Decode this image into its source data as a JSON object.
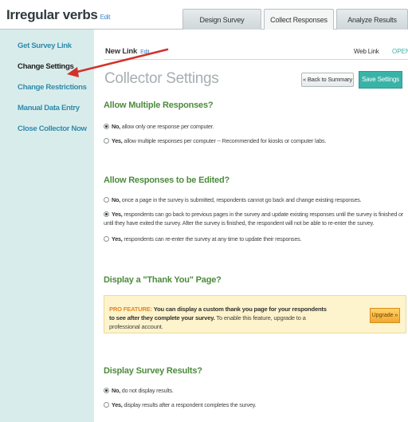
{
  "header": {
    "survey_title": "Irregular verbs",
    "edit": "Edit",
    "tabs": [
      "Design Survey",
      "Collect Responses",
      "Analyze Results"
    ],
    "active_tab": "Collect Responses"
  },
  "sidebar": {
    "items": [
      {
        "label": "Get Survey Link"
      },
      {
        "label": "Change Settings"
      },
      {
        "label": "Change Restrictions"
      },
      {
        "label": "Manual Data Entry"
      },
      {
        "label": "Close Collector Now"
      }
    ],
    "active": "Change Settings"
  },
  "main": {
    "new_link": "New Link",
    "edit": "Edit",
    "web_link": "Web Link",
    "status": "OPEN",
    "title": "Collector Settings",
    "back_button": "« Back to Summary",
    "save_button": "Save Settings"
  },
  "sections": {
    "multiple": {
      "heading": "Allow Multiple Responses?",
      "options": [
        {
          "lead": "No,",
          "text": " allow only one response per computer.",
          "checked": true
        },
        {
          "lead": "Yes,",
          "text": " allow multiple responses per computer -- Recommended for kiosks or computer labs.",
          "checked": false
        }
      ]
    },
    "edit": {
      "heading": "Allow Responses to be Edited?",
      "options": [
        {
          "lead": "No,",
          "text": " once a page in the survey is submitted, respondents cannot go back and change existing responses.",
          "checked": false
        },
        {
          "lead": "Yes,",
          "text": " respondents can go back to previous pages in the survey and update existing responses until the survey is finished or until they have exited the survey. After the survey is finished, the respondent will not be able to re-enter the survey.",
          "checked": true
        },
        {
          "lead": "Yes,",
          "text": " respondents can re-enter the survey at any time to update their responses.",
          "checked": false
        }
      ]
    },
    "thankyou": {
      "heading": "Display a \"Thank You\" Page?",
      "pro_label": "PRO FEATURE:",
      "pro_strong": " You can display a custom thank you page for your respondents to see after they complete your survey.",
      "pro_rest": " To enable this feature, upgrade to a professional account.",
      "upgrade": "Upgrade »"
    },
    "results": {
      "heading": "Display Survey Results?",
      "options": [
        {
          "lead": "No,",
          "text": " do not display results.",
          "checked": true
        },
        {
          "lead": "Yes,",
          "text": " display results after a respondent completes the survey.",
          "checked": false
        }
      ]
    }
  },
  "colors": {
    "accent": "#39b3a8",
    "heading": "#4c8b3c",
    "sidebar_bg": "#d9ecec",
    "annotation_arrow": "#d1322b"
  }
}
